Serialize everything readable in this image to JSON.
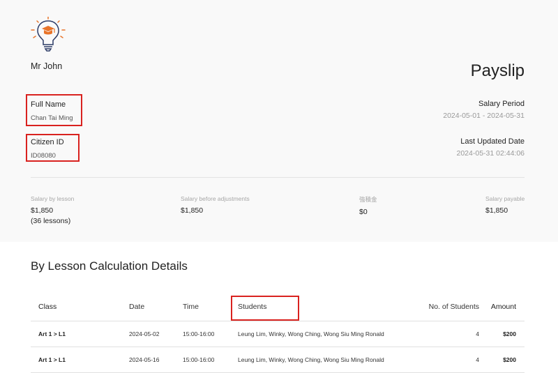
{
  "header": {
    "company_name": "Mr John",
    "title": "Payslip"
  },
  "employee": {
    "full_name_label": "Full Name",
    "full_name_value": "Chan Tai Ming",
    "citizen_id_label": "Citizen ID",
    "citizen_id_value": "ID08080"
  },
  "period": {
    "salary_period_label": "Salary Period",
    "salary_period_value": "2024-05-01 - 2024-05-31",
    "last_updated_label": "Last Updated Date",
    "last_updated_value": "2024-05-31 02:44:06"
  },
  "summary": {
    "by_lesson_label": "Salary by lesson",
    "by_lesson_value": "$1,850",
    "by_lesson_note": "(36 lessons)",
    "before_adj_label": "Salary before adjustments",
    "before_adj_value": "$1,850",
    "mpf_label": "強積金",
    "mpf_value": "$0",
    "payable_label": "Salary payable",
    "payable_value": "$1,850"
  },
  "details": {
    "section_title": "By Lesson Calculation Details",
    "columns": [
      "Class",
      "Date",
      "Time",
      "Students",
      "No. of Students",
      "Amount"
    ],
    "rows": [
      [
        "Art 1 > L1",
        "2024-05-02",
        "15:00-16:00",
        "Leung Lim, Winky, Wong Ching, Wong Siu Ming Ronald",
        "4",
        "$200"
      ],
      [
        "Art 1 > L1",
        "2024-05-16",
        "15:00-16:00",
        "Leung Lim, Winky, Wong Ching, Wong Siu Ming Ronald",
        "4",
        "$200"
      ]
    ]
  },
  "icons": {
    "logo": "lightbulb-graduation-cap-icon"
  },
  "colors": {
    "highlight": "#d9221f",
    "logo_orange": "#e8742a",
    "logo_navy": "#2b3a66"
  }
}
